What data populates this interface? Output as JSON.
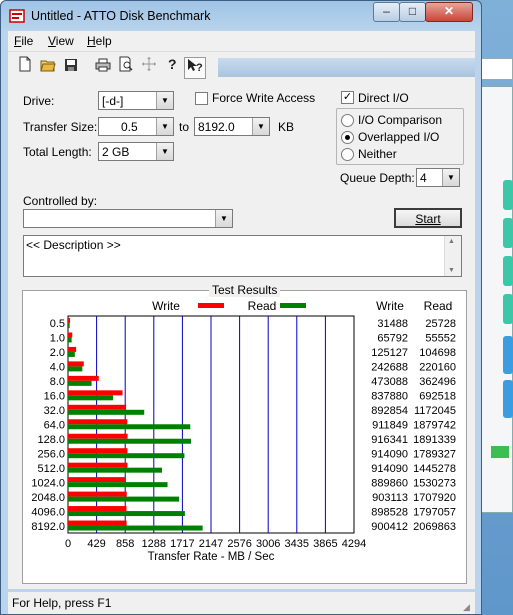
{
  "window": {
    "title": "Untitled - ATTO Disk Benchmark"
  },
  "caption_buttons": {
    "minimize": "–",
    "maximize": "□",
    "close": "✕"
  },
  "menu": [
    {
      "label": "File",
      "accel": "F",
      "rest": "ile"
    },
    {
      "label": "View",
      "accel": "V",
      "rest": "iew"
    },
    {
      "label": "Help",
      "accel": "H",
      "rest": "elp"
    }
  ],
  "toolbar": [
    "new-icon",
    "open-icon",
    "save-icon",
    "print-icon",
    "print-preview-icon",
    "move-icon",
    "help-icon",
    "context-help-icon"
  ],
  "form": {
    "drive_label": "Drive:",
    "drive_value": "[-d-]",
    "force_write_label": "Force Write Access",
    "force_write_checked": false,
    "direct_io_label": "Direct I/O",
    "direct_io_checked": true,
    "transfer_size_label": "Transfer Size:",
    "transfer_from": "0.5",
    "to_label": "to",
    "transfer_to": "8192.0",
    "kb_label": "KB",
    "total_length_label": "Total Length:",
    "total_length_value": "2 GB",
    "io_options": [
      {
        "label": "I/O Comparison",
        "checked": false
      },
      {
        "label": "Overlapped I/O",
        "checked": true
      },
      {
        "label": "Neither",
        "checked": false
      }
    ],
    "queue_depth_label": "Queue Depth:",
    "queue_depth_value": "4",
    "controlled_by_label": "Controlled by:",
    "controlled_by_value": "",
    "start_label": "Start",
    "description": "<< Description >>"
  },
  "results": {
    "title": "Test Results",
    "legend_write": "Write",
    "legend_read": "Read",
    "col_write": "Write",
    "col_read": "Read",
    "write_color": "#ff0000",
    "read_color": "#008000"
  },
  "chart_data": {
    "type": "bar",
    "orientation": "horizontal",
    "xlabel": "Transfer Rate - MB / Sec",
    "x_ticks": [
      "0",
      "429",
      "858",
      "1288",
      "1717",
      "2147",
      "2576",
      "3006",
      "3435",
      "3865",
      "4294"
    ],
    "xlim": [
      0,
      4294
    ],
    "grid": true,
    "categories": [
      "0.5",
      "1.0",
      "2.0",
      "4.0",
      "8.0",
      "16.0",
      "32.0",
      "64.0",
      "128.0",
      "256.0",
      "512.0",
      "1024.0",
      "2048.0",
      "4096.0",
      "8192.0"
    ],
    "series": [
      {
        "name": "Write",
        "values": [
          31488,
          65792,
          125127,
          242688,
          473088,
          837880,
          892854,
          911849,
          916341,
          914090,
          914090,
          889860,
          903113,
          898528,
          900412
        ]
      },
      {
        "name": "Read",
        "values": [
          25728,
          55552,
          104698,
          220160,
          362496,
          692518,
          1172045,
          1879742,
          1891339,
          1789327,
          1445278,
          1530273,
          1707920,
          1797057,
          2069863
        ]
      }
    ]
  },
  "status": {
    "text": "For Help, press F1"
  }
}
